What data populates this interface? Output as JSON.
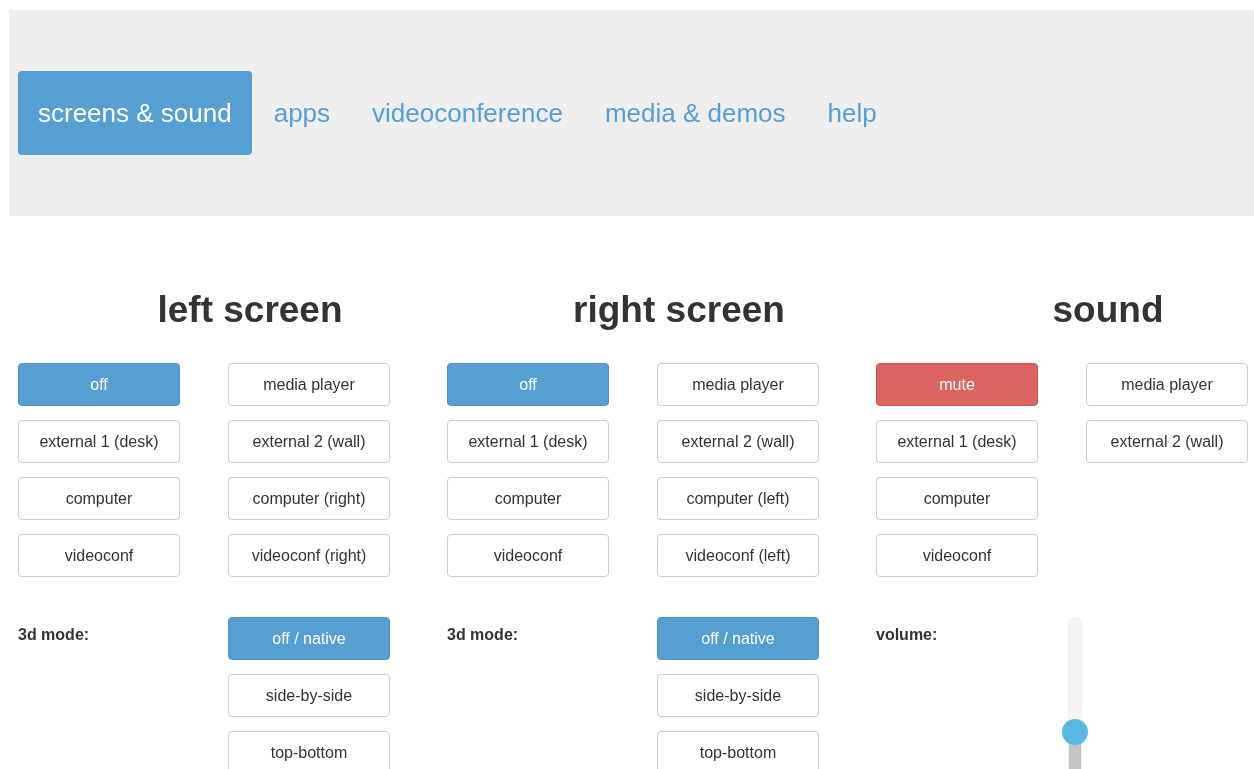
{
  "nav": {
    "tabs": [
      {
        "label": "screens & sound",
        "selected": true
      },
      {
        "label": "apps",
        "selected": false
      },
      {
        "label": "videoconference",
        "selected": false
      },
      {
        "label": "media & demos",
        "selected": false
      },
      {
        "label": "help",
        "selected": false
      }
    ]
  },
  "sections": [
    {
      "kind": "screen",
      "title": "left screen",
      "source_columns": [
        [
          {
            "label": "off",
            "kind": "source",
            "selected": true
          },
          {
            "label": "external 1 (desk)",
            "kind": "source",
            "selected": false
          },
          {
            "label": "computer",
            "kind": "source",
            "selected": false
          },
          {
            "label": "videoconf",
            "kind": "source",
            "selected": false
          }
        ],
        [
          {
            "label": "media player",
            "kind": "source",
            "selected": false
          },
          {
            "label": "external 2 (wall)",
            "kind": "source",
            "selected": false
          },
          {
            "label": "computer (right)",
            "kind": "source",
            "selected": false
          },
          {
            "label": "videoconf (right)",
            "kind": "source",
            "selected": false
          }
        ]
      ],
      "mode": {
        "label": "3d mode:",
        "options": [
          {
            "label": "off / native",
            "selected": true
          },
          {
            "label": "side-by-side",
            "selected": false
          },
          {
            "label": "top-bottom",
            "selected": false
          }
        ]
      }
    },
    {
      "kind": "screen",
      "title": "right screen",
      "source_columns": [
        [
          {
            "label": "off",
            "kind": "source",
            "selected": true
          },
          {
            "label": "external 1 (desk)",
            "kind": "source",
            "selected": false
          },
          {
            "label": "computer",
            "kind": "source",
            "selected": false
          },
          {
            "label": "videoconf",
            "kind": "source",
            "selected": false
          }
        ],
        [
          {
            "label": "media player",
            "kind": "source",
            "selected": false
          },
          {
            "label": "external 2 (wall)",
            "kind": "source",
            "selected": false
          },
          {
            "label": "computer (left)",
            "kind": "source",
            "selected": false
          },
          {
            "label": "videoconf (left)",
            "kind": "source",
            "selected": false
          }
        ]
      ],
      "mode": {
        "label": "3d mode:",
        "options": [
          {
            "label": "off / native",
            "selected": true
          },
          {
            "label": "side-by-side",
            "selected": false
          },
          {
            "label": "top-bottom",
            "selected": false
          }
        ]
      }
    },
    {
      "kind": "sound",
      "title": "sound",
      "source_columns": [
        [
          {
            "label": "mute",
            "kind": "mute",
            "selected": true
          },
          {
            "label": "external 1 (desk)",
            "kind": "source",
            "selected": false
          },
          {
            "label": "computer",
            "kind": "source",
            "selected": false
          },
          {
            "label": "videoconf",
            "kind": "source",
            "selected": false
          }
        ],
        [
          {
            "label": "media player",
            "kind": "source",
            "selected": false
          },
          {
            "label": "external 2 (wall)",
            "kind": "source",
            "selected": false
          }
        ]
      ],
      "volume": {
        "label": "volume:",
        "level": 0.36
      }
    }
  ]
}
